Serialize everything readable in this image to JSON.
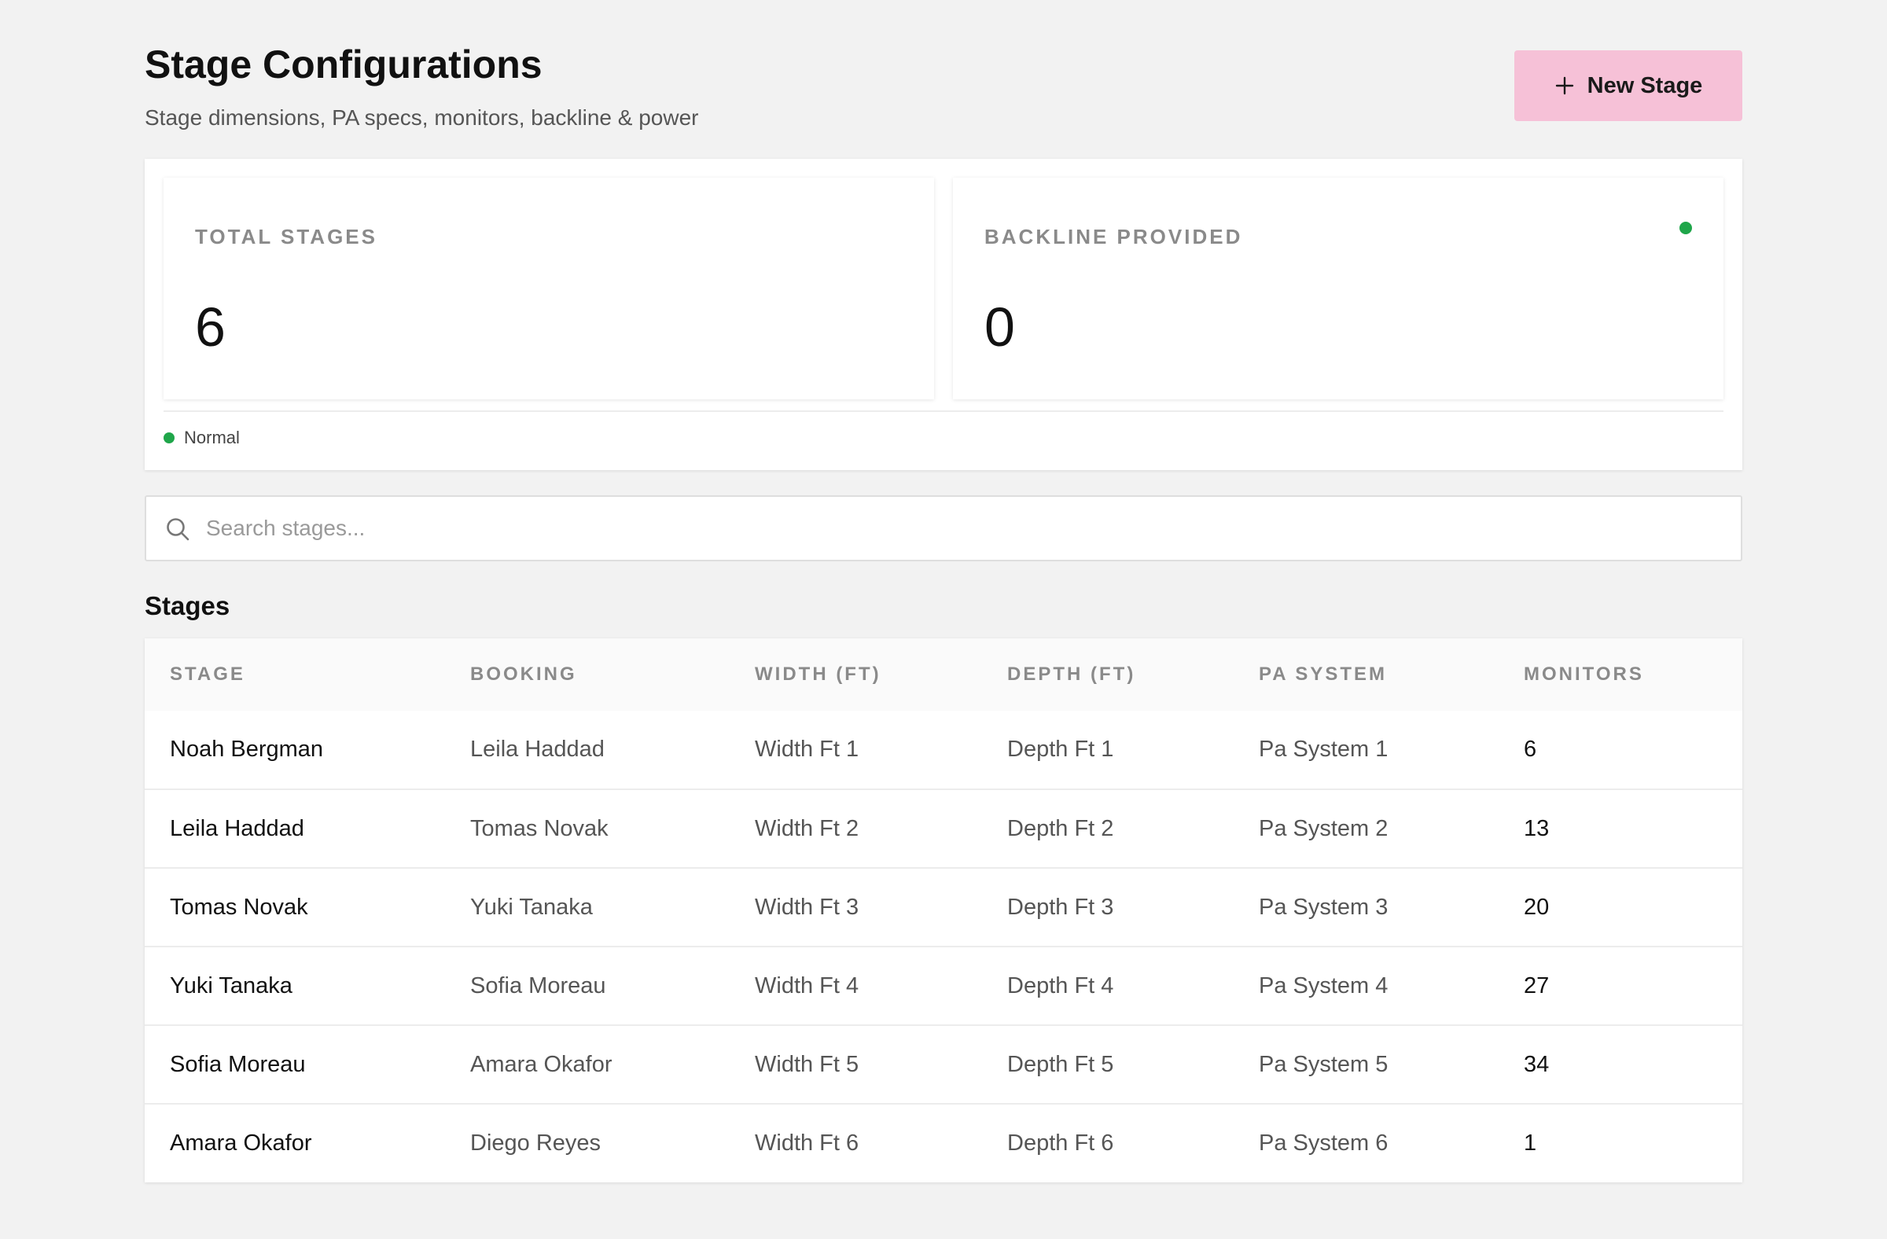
{
  "header": {
    "title": "Stage Configurations",
    "subtitle": "Stage dimensions, PA specs, monitors, backline & power",
    "new_button_label": "New Stage"
  },
  "stats": {
    "total_stages": {
      "label": "TOTAL STAGES",
      "value": "6"
    },
    "backline_provided": {
      "label": "BACKLINE PROVIDED",
      "value": "0"
    },
    "status_label": "Normal"
  },
  "search": {
    "placeholder": "Search stages..."
  },
  "section_title": "Stages",
  "table": {
    "columns": [
      "STAGE",
      "BOOKING",
      "WIDTH (FT)",
      "DEPTH (FT)",
      "PA SYSTEM",
      "MONITORS"
    ],
    "rows": [
      [
        "Noah Bergman",
        "Leila Haddad",
        "Width Ft 1",
        "Depth Ft 1",
        "Pa System 1",
        "6"
      ],
      [
        "Leila Haddad",
        "Tomas Novak",
        "Width Ft 2",
        "Depth Ft 2",
        "Pa System 2",
        "13"
      ],
      [
        "Tomas Novak",
        "Yuki Tanaka",
        "Width Ft 3",
        "Depth Ft 3",
        "Pa System 3",
        "20"
      ],
      [
        "Yuki Tanaka",
        "Sofia Moreau",
        "Width Ft 4",
        "Depth Ft 4",
        "Pa System 4",
        "27"
      ],
      [
        "Sofia Moreau",
        "Amara Okafor",
        "Width Ft 5",
        "Depth Ft 5",
        "Pa System 5",
        "34"
      ],
      [
        "Amara Okafor",
        "Diego Reyes",
        "Width Ft 6",
        "Depth Ft 6",
        "Pa System 6",
        "1"
      ]
    ]
  },
  "colors": {
    "accent_pink": "#f6c1d7",
    "status_green": "#1fa64a",
    "background": "#f2f2f2"
  },
  "icons": {
    "new_button": "plus-icon",
    "search": "search-icon"
  }
}
